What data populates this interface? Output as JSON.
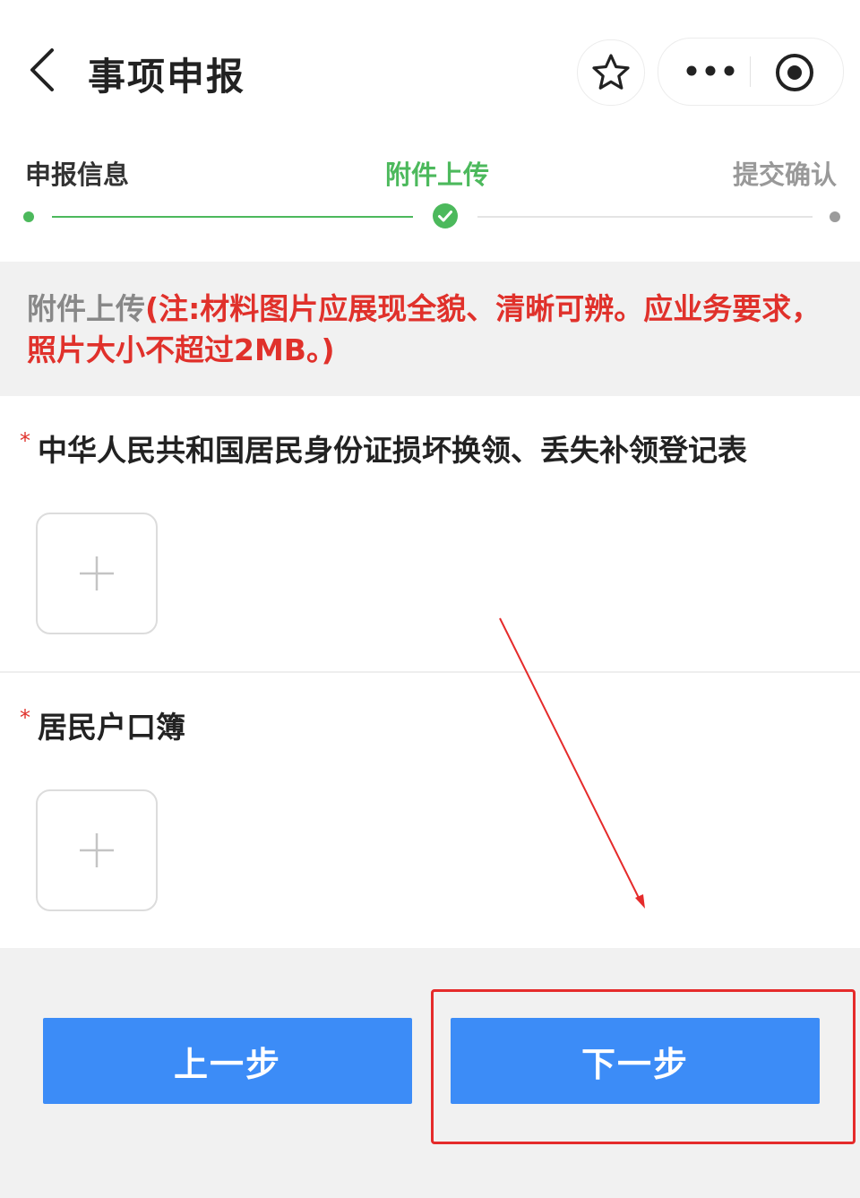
{
  "header": {
    "title": "事项申报",
    "icons": [
      "chevron-left-icon",
      "star-icon",
      "more-icon",
      "target-icon"
    ]
  },
  "steps": [
    {
      "label": "申报信息",
      "state": "done"
    },
    {
      "label": "附件上传",
      "state": "current"
    },
    {
      "label": "提交确认",
      "state": "pending"
    }
  ],
  "notice": {
    "prefix": "附件上传",
    "warning": "(注:材料图片应展现全貌、清晰可辨。应业务要求，照片大小不超过2MB。)"
  },
  "documents": [
    {
      "required_mark": "*",
      "title": "中华人民共和国居民身份证损坏换领、丢失补领登记表"
    },
    {
      "required_mark": "*",
      "title": "居民户口簿"
    }
  ],
  "buttons": {
    "prev": "上一步",
    "next": "下一步"
  },
  "colors": {
    "accent": "#4cb95c",
    "primary_button": "#3c8cf7",
    "warning_text": "#e0312b",
    "annotation": "#e52b2b"
  }
}
